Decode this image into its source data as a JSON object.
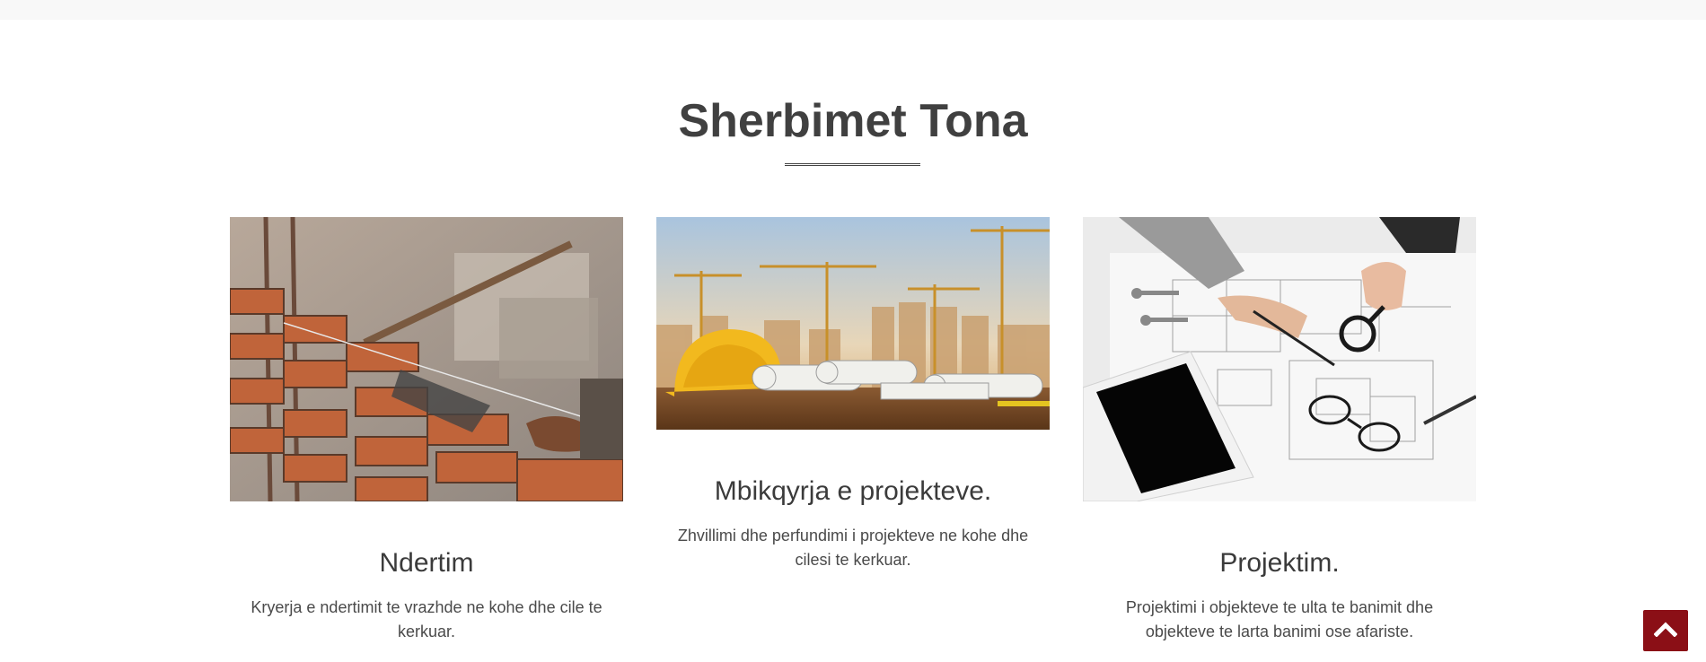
{
  "section": {
    "title": "Sherbimet Tona"
  },
  "services": [
    {
      "title": "Ndertim",
      "description": "Kryerja e ndertimit te vrazhde ne kohe dhe cile te kerkuar.",
      "image_icon": "brick-wall-construction-image"
    },
    {
      "title": "Mbikqyrja e projekteve.",
      "description": "Zhvillimi dhe perfundimi i projekteve ne kohe dhe cilesi te kerkuar.",
      "image_icon": "cranes-hardhat-blueprints-image"
    },
    {
      "title": "Projektim.",
      "description": "Projektimi i objekteve te ulta te banimit dhe objekteve te larta banimi ose afariste.",
      "image_icon": "architect-blueprint-planning-image"
    }
  ],
  "scroll_top": {
    "icon": "chevron-up-icon",
    "color": "#8b0f16"
  },
  "colors": {
    "title": "#404040",
    "topbar": "#f8f8f8",
    "accent": "#8b0f16"
  }
}
